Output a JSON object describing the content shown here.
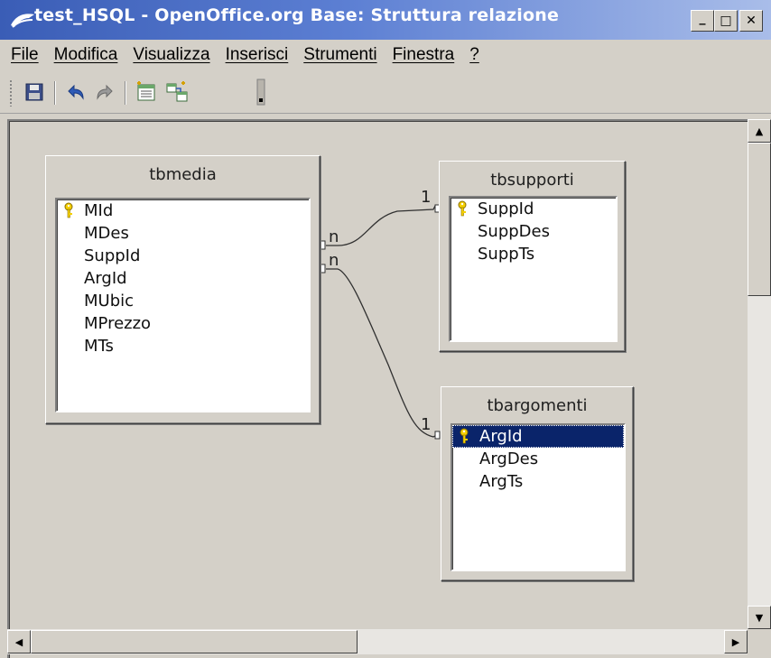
{
  "window": {
    "title": "test_HSQL - OpenOffice.org Base: Struttura relazione",
    "minimize": "_",
    "maximize": "□",
    "close": "✕"
  },
  "menu": [
    {
      "label": "File"
    },
    {
      "label": "Modifica"
    },
    {
      "label": "Visualizza"
    },
    {
      "label": "Inserisci"
    },
    {
      "label": "Strumenti"
    },
    {
      "label": "Finestra"
    },
    {
      "label": "?"
    }
  ],
  "toolbar": {
    "icons": [
      "save-icon",
      "undo-icon",
      "redo-icon",
      "new-relation-icon",
      "add-tables-icon",
      "toolbar-overflow-icon"
    ]
  },
  "tables": {
    "tbmedia": {
      "title": "tbmedia",
      "fields": [
        "MId",
        "MDes",
        "SuppId",
        "ArgId",
        "MUbic",
        "MPrezzo",
        "MTs"
      ],
      "primary_key": "MId"
    },
    "tbsupporti": {
      "title": "tbsupporti",
      "fields": [
        "SuppId",
        "SuppDes",
        "SuppTs"
      ],
      "primary_key": "SuppId"
    },
    "tbargomenti": {
      "title": "tbargomenti",
      "fields": [
        "ArgId",
        "ArgDes",
        "ArgTs"
      ],
      "primary_key": "ArgId",
      "selected_field": "ArgId"
    }
  },
  "relations": [
    {
      "from_table": "tbmedia",
      "from_card": "n",
      "to_table": "tbsupporti",
      "to_card": "1"
    },
    {
      "from_table": "tbmedia",
      "from_card": "n",
      "to_table": "tbargomenti",
      "to_card": "1"
    }
  ],
  "colors": {
    "selection": "#0a246a",
    "title_gradient_start": "#3a5db6",
    "key_icon": "#f5d000"
  }
}
